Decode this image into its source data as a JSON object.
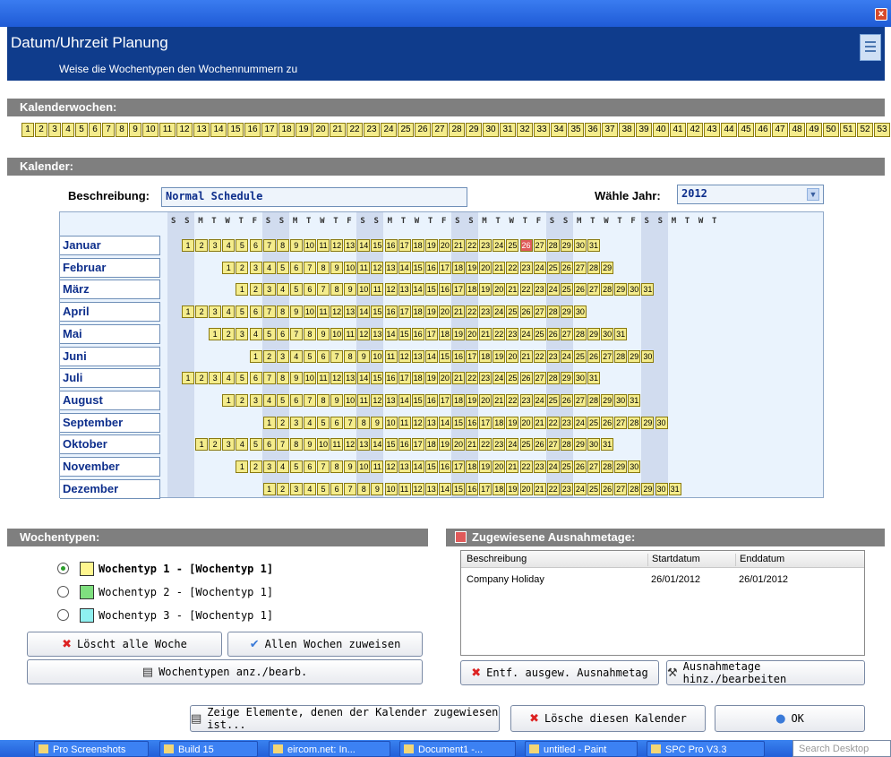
{
  "window": {
    "title": "Datum/Uhrzeit Planung",
    "subtitle": "Weise die Wochentypen den Wochennummern zu",
    "close_glyph": "x"
  },
  "sections": {
    "weeks": "Kalenderwochen:",
    "calendar": "Kalender:",
    "weektypes": "Wochentypen:",
    "exceptions": "Zugewiesene Ausnahmetage:"
  },
  "week_numbers": [
    1,
    2,
    3,
    4,
    5,
    6,
    7,
    8,
    9,
    10,
    11,
    12,
    13,
    14,
    15,
    16,
    17,
    18,
    19,
    20,
    21,
    22,
    23,
    24,
    25,
    26,
    27,
    28,
    29,
    30,
    31,
    32,
    33,
    34,
    35,
    36,
    37,
    38,
    39,
    40,
    41,
    42,
    43,
    44,
    45,
    46,
    47,
    48,
    49,
    50,
    51,
    52,
    53
  ],
  "form": {
    "desc_label": "Beschreibung:",
    "desc_value": "Normal Schedule",
    "year_label": "Wähle Jahr:",
    "year_value": "2012"
  },
  "calendar": {
    "day_headers": [
      "S",
      "S",
      "M",
      "T",
      "W",
      "T",
      "F",
      "S",
      "S",
      "M",
      "T",
      "W",
      "T",
      "F",
      "S",
      "S",
      "M",
      "T",
      "W",
      "T",
      "F",
      "S",
      "S",
      "M",
      "T",
      "W",
      "T",
      "F",
      "S",
      "S",
      "M",
      "T",
      "W",
      "T",
      "F",
      "S",
      "S",
      "M",
      "T",
      "W",
      "T"
    ],
    "months": [
      {
        "name": "Januar",
        "offset": 0,
        "days": 31,
        "highlight": [
          26
        ]
      },
      {
        "name": "Februar",
        "offset": 3,
        "days": 29
      },
      {
        "name": "März",
        "offset": 4,
        "days": 31
      },
      {
        "name": "April",
        "offset": 0,
        "days": 30
      },
      {
        "name": "Mai",
        "offset": 2,
        "days": 31
      },
      {
        "name": "Juni",
        "offset": 5,
        "days": 30
      },
      {
        "name": "Juli",
        "offset": 0,
        "days": 31
      },
      {
        "name": "August",
        "offset": 3,
        "days": 31
      },
      {
        "name": "September",
        "offset": 6,
        "days": 30
      },
      {
        "name": "Oktober",
        "offset": 1,
        "days": 31
      },
      {
        "name": "November",
        "offset": 4,
        "days": 30
      },
      {
        "name": "Dezember",
        "offset": 6,
        "days": 31
      }
    ]
  },
  "weektypes": [
    {
      "label": "Wochentyp 1 - [Wochentyp 1]",
      "color": "#fff68f",
      "selected": true
    },
    {
      "label": "Wochentyp 2 - [Wochentyp 1]",
      "color": "#7fe07f",
      "selected": false
    },
    {
      "label": "Wochentyp 3 - [Wochentyp 1]",
      "color": "#8ff0f0",
      "selected": false
    }
  ],
  "buttons": {
    "clear_all": "Löscht alle Woche",
    "assign_all": "Allen Wochen zuweisen",
    "edit_types": "Wochentypen anz./bearb.",
    "remove_exception": "Entf. ausgew. Ausnahmetag",
    "add_exception": "Ausnahmetage hinz./bearbeiten",
    "show_elements": "Zeige Elemente, denen der Kalender zugewiesen ist...",
    "delete_calendar": "Lösche diesen Kalender",
    "ok": "OK"
  },
  "exceptions": {
    "columns": [
      "Beschreibung",
      "Startdatum",
      "Enddatum"
    ],
    "rows": [
      {
        "desc": "Company Holiday",
        "start": "26/01/2012",
        "end": "26/01/2012"
      }
    ]
  },
  "taskbar": {
    "items": [
      "Pro Screenshots",
      "Build 15",
      "eircom.net: In...",
      "Document1 -...",
      "untitled - Paint",
      "SPC Pro V3.3"
    ],
    "search": "Search Desktop"
  },
  "colors": {
    "header_bg": "#0f3c8c",
    "section_bar": "#7f7f7f",
    "day_box": "#f4ec8c",
    "exception_day": "#e05a5a"
  }
}
